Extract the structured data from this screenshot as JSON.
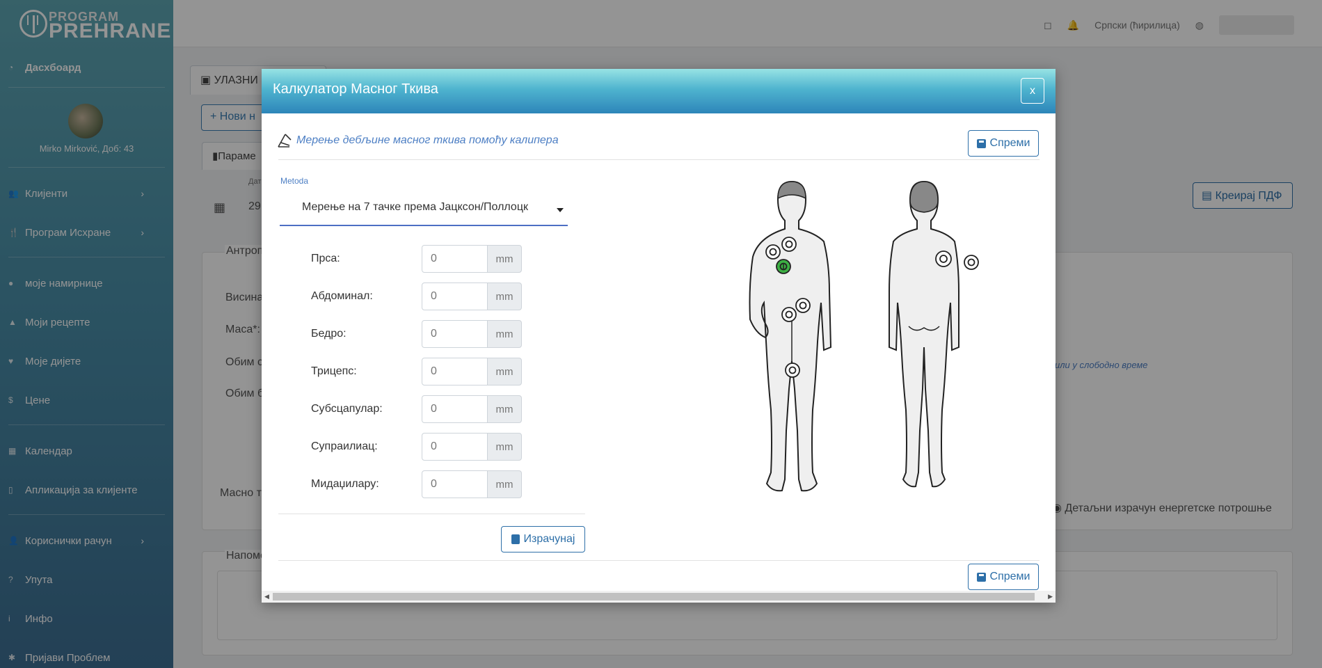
{
  "sidebar": {
    "logo_top": "PROGRAM",
    "logo_bottom": "PREHRANE",
    "dashboard": "Дасхбоард",
    "user_line": "Mirko Mirković, Доб: 43",
    "items": [
      {
        "label": "Клијенти",
        "icon": "users-icon",
        "arrow": "›"
      },
      {
        "label": "Програм Исхране",
        "icon": "utensils-icon",
        "arrow": "›"
      },
      {
        "label": "моје намирнице",
        "icon": "apple-icon",
        "arrow": ""
      },
      {
        "label": "Моји рецепте",
        "icon": "recipe-icon",
        "arrow": ""
      },
      {
        "label": "Моје дијете",
        "icon": "heart-icon",
        "arrow": ""
      },
      {
        "label": "Цене",
        "icon": "dollar-icon",
        "arrow": ""
      },
      {
        "label": "Календар",
        "icon": "calendar-icon",
        "arrow": ""
      },
      {
        "label": "Апликација за клијенте",
        "icon": "mobile-icon",
        "arrow": ""
      },
      {
        "label": "Кориснички рачун",
        "icon": "user-cog-icon",
        "arrow": "›"
      },
      {
        "label": "Упута",
        "icon": "question-icon",
        "arrow": ""
      },
      {
        "label": "Инфо",
        "icon": "info-icon",
        "arrow": ""
      },
      {
        "label": "Пријави Проблем",
        "icon": "bug-icon",
        "arrow": ""
      }
    ]
  },
  "topbar": {
    "language": "Српски (ћирилица)"
  },
  "background": {
    "tab_main": "УЛАЗНИ",
    "new_button": "Нови н",
    "tab_params": "Параме",
    "date_label": "Дат",
    "date_value": "29.",
    "section_title": "Антроп",
    "height_label": "Висина",
    "mass_label": "Маса*:",
    "circ1_label": "Обим с",
    "circ2_label": "Обим б",
    "fat_label": "Масно т",
    "notes_label": "Напоме",
    "pdf_button": "Креирај ПДФ",
    "leisure_text": "или у слободно време",
    "energy_link": "Детаљни израчун енергетске потрошње"
  },
  "modal": {
    "title": "Калкулатор Масног Ткива",
    "close": "x",
    "subtitle": "Мерење дебљине масног ткива помоћу калипера",
    "save_label": "Спреми",
    "method_label": "Metoda",
    "method_value": "Мерење на 7 тачке према Јацксон/Поллоцк",
    "measurements": [
      {
        "label": "Прса:",
        "placeholder": "0",
        "unit": "mm"
      },
      {
        "label": "Абдоминал:",
        "placeholder": "0",
        "unit": "mm"
      },
      {
        "label": "Бедро:",
        "placeholder": "0",
        "unit": "mm"
      },
      {
        "label": "Трицепс:",
        "placeholder": "0",
        "unit": "mm"
      },
      {
        "label": "Субсцапулар:",
        "placeholder": "0",
        "unit": "mm"
      },
      {
        "label": "Супраилиац:",
        "placeholder": "0",
        "unit": "mm"
      },
      {
        "label": "Мидаџилару:",
        "placeholder": "0",
        "unit": "mm"
      }
    ],
    "calculate_label": "Израчунај",
    "active_point_color": "#3cb043"
  }
}
